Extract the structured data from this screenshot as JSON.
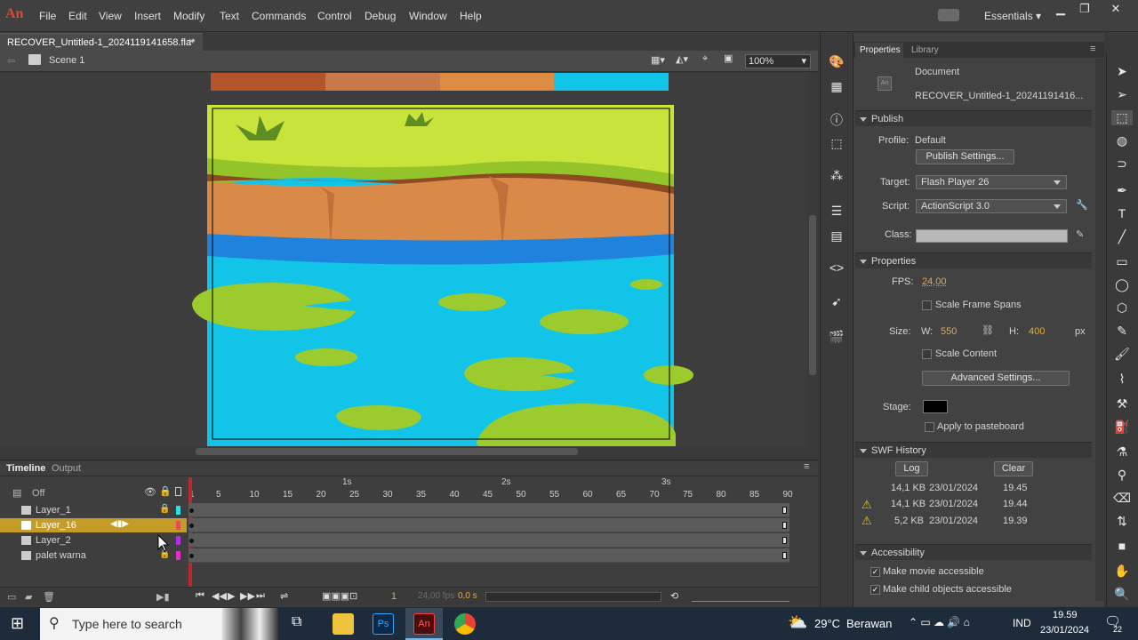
{
  "app": {
    "logo": "An"
  },
  "menu": [
    "File",
    "Edit",
    "View",
    "Insert",
    "Modify",
    "Text",
    "Commands",
    "Control",
    "Debug",
    "Window",
    "Help"
  ],
  "workspace": "Essentials",
  "document_tab": {
    "title": "RECOVER_Untitled-1_2024119141658.fla*",
    "close": "×"
  },
  "scene": {
    "label": "Scene 1",
    "zoom": "100%"
  },
  "palette_colors": [
    "#b4542a",
    "#c9784a",
    "#dd8b45",
    "#12c5e8"
  ],
  "properties_panel": {
    "tabs": [
      "Properties",
      "Library"
    ],
    "doc_type": "Document",
    "doc_name": "RECOVER_Untitled-1_20241191416...",
    "publish": {
      "section": "Publish",
      "profile_label": "Profile:",
      "profile_value": "Default",
      "publish_settings_button": "Publish Settings...",
      "target_label": "Target:",
      "target_value": "Flash Player 26",
      "script_label": "Script:",
      "script_value": "ActionScript 3.0",
      "class_label": "Class:"
    },
    "properties": {
      "section": "Properties",
      "fps_label": "FPS:",
      "fps_value": "24,00",
      "scale_frame_spans": "Scale Frame Spans",
      "size_label": "Size:",
      "w_label": "W:",
      "w_value": "550",
      "h_label": "H:",
      "h_value": "400",
      "unit": "px",
      "scale_content": "Scale Content",
      "advanced_settings_button": "Advanced Settings...",
      "stage_label": "Stage:",
      "stage_color": "#000000",
      "apply_to_pasteboard": "Apply to pasteboard"
    },
    "swf_history": {
      "section": "SWF History",
      "log_button": "Log",
      "clear_button": "Clear",
      "rows": [
        {
          "size": "14,1 KB",
          "date": "23/01/2024",
          "time": "19.45",
          "warn": false
        },
        {
          "size": "14,1 KB",
          "date": "23/01/2024",
          "time": "19.44",
          "warn": true
        },
        {
          "size": "5,2 KB",
          "date": "23/01/2024",
          "time": "19.39",
          "warn": true
        }
      ]
    },
    "accessibility": {
      "section": "Accessibility",
      "make_movie_accessible": "Make movie accessible",
      "make_child_accessible": "Make child objects accessible"
    }
  },
  "timeline": {
    "tabs": [
      "Timeline",
      "Output"
    ],
    "off_label": "Off",
    "seconds": [
      "1s",
      "2s",
      "3s"
    ],
    "frame_ticks": [
      "1",
      "5",
      "10",
      "15",
      "20",
      "25",
      "30",
      "35",
      "40",
      "45",
      "50",
      "55",
      "60",
      "65",
      "70",
      "75",
      "80",
      "85",
      "90"
    ],
    "layers": [
      {
        "name": "Layer_1",
        "color": "#2de0e0",
        "selected": false
      },
      {
        "name": "Layer_16",
        "color": "#e05050",
        "selected": true
      },
      {
        "name": "Layer_2",
        "color": "#b030e0",
        "selected": false
      },
      {
        "name": "palet warna",
        "color": "#e030c0",
        "selected": false
      }
    ],
    "status": {
      "frame": "1",
      "fps": "24,00 fps",
      "time": "0,0 s"
    }
  },
  "taskbar": {
    "search_placeholder": "Type here to search",
    "weather_temp": "29°C",
    "weather_text": "Berawan",
    "lang": "IND",
    "time": "19.59",
    "date": "23/01/2024",
    "notifications": "22"
  }
}
